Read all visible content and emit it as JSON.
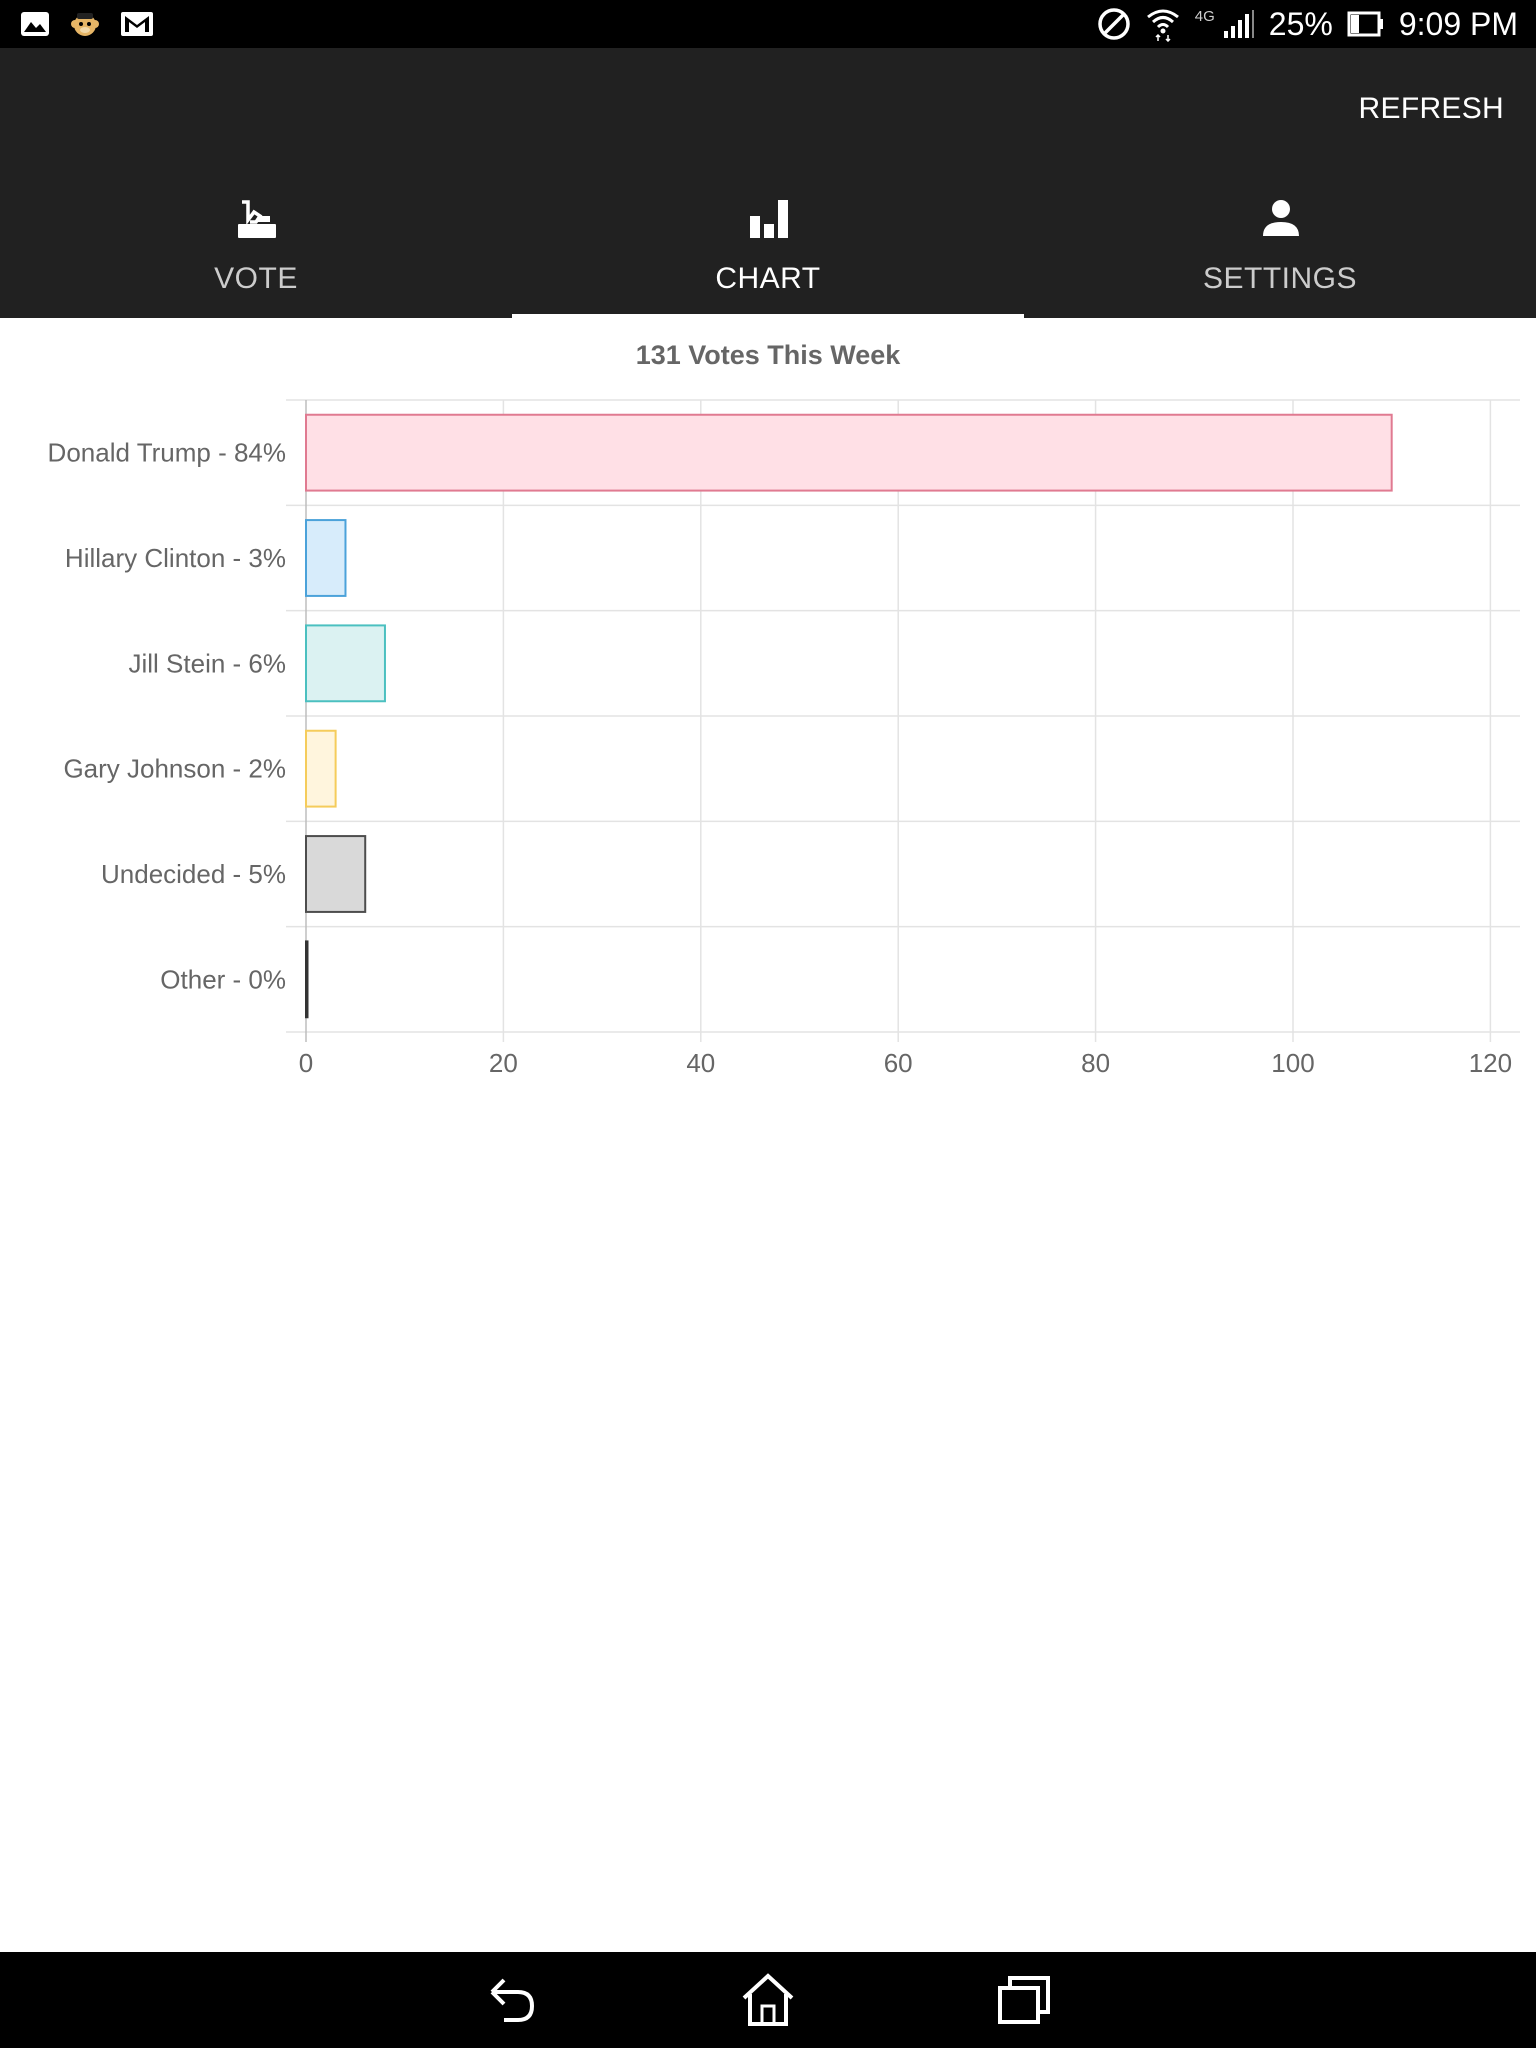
{
  "status_bar": {
    "battery": "25%",
    "time": "9:09 PM",
    "network": "4G"
  },
  "header": {
    "refresh_label": "REFRESH"
  },
  "tabs": [
    {
      "label": "VOTE",
      "icon": "ballot-box-icon",
      "active": false
    },
    {
      "label": "CHART",
      "icon": "bar-chart-icon",
      "active": true
    },
    {
      "label": "SETTINGS",
      "icon": "person-icon",
      "active": false
    }
  ],
  "chart_data": {
    "type": "bar",
    "orientation": "horizontal",
    "title": "131 Votes This Week",
    "categories": [
      "Donald Trump - 84%",
      "Hillary Clinton - 3%",
      "Jill Stein - 6%",
      "Gary Johnson - 2%",
      "Undecided - 5%",
      "Other - 0%"
    ],
    "values": [
      110,
      4,
      8,
      3,
      6,
      0
    ],
    "xlim": [
      0,
      123
    ],
    "xticks": [
      "0",
      "20",
      "40",
      "60",
      "80",
      "100",
      "120"
    ],
    "xtick_values": [
      0,
      20,
      40,
      60,
      80,
      100,
      120
    ],
    "grid": true,
    "fill_colors": [
      "#ffe0e6",
      "#d7ecfb",
      "#dbf2f2",
      "#fff5dd",
      "#d9d9d9",
      "#d9d9d9"
    ],
    "stroke_colors": [
      "#e07a91",
      "#4ba2da",
      "#4bc0c0",
      "#f5cc5b",
      "#4d4d4d",
      "#333333"
    ]
  }
}
